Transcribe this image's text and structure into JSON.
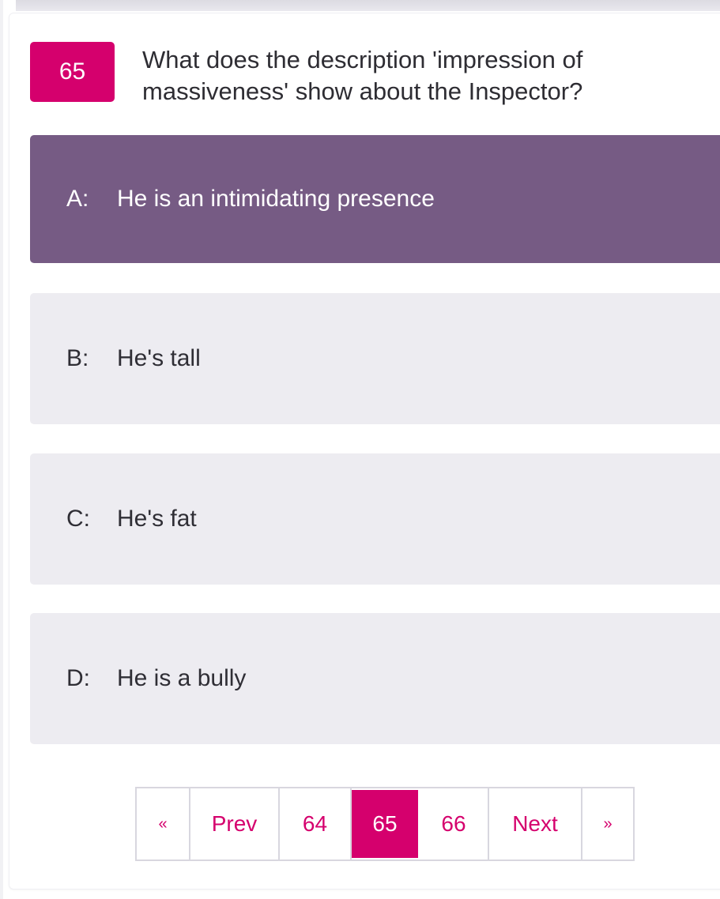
{
  "question": {
    "number": "65",
    "text": "What does the description 'impression of massiveness' show about the Inspector?"
  },
  "options": [
    {
      "letter": "A:",
      "text": "He is an intimidating presence",
      "selected": true
    },
    {
      "letter": "B:",
      "text": "He's tall",
      "selected": false
    },
    {
      "letter": "C:",
      "text": "He's fat",
      "selected": false
    },
    {
      "letter": "D:",
      "text": "He is a bully",
      "selected": false
    }
  ],
  "pagination": {
    "first": "«",
    "prev": "Prev",
    "pages": [
      "64",
      "65",
      "66"
    ],
    "current": "65",
    "next": "Next",
    "last": "»"
  },
  "colors": {
    "accent": "#d5006d",
    "selected_option": "#765b84",
    "option_bg": "#edecf1"
  }
}
